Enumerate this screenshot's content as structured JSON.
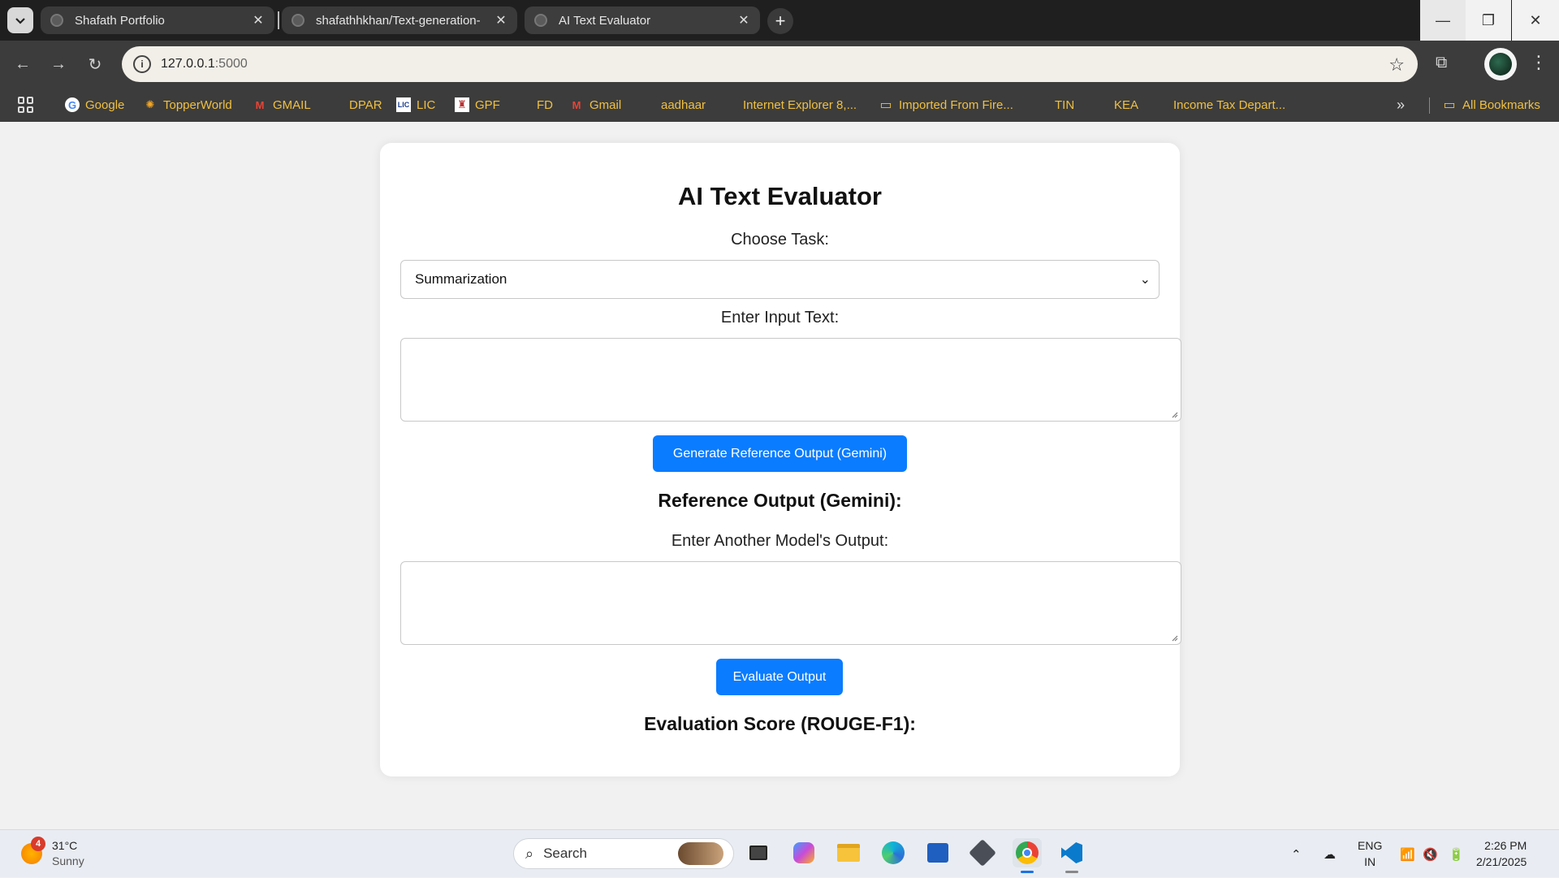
{
  "browser": {
    "tabs": [
      {
        "title": "Shafath Portfolio",
        "active": false
      },
      {
        "title": "shafathhkhan/Text-generation-",
        "active": false
      },
      {
        "title": "AI Text Evaluator",
        "active": true
      }
    ],
    "url_host": "127.0.0.1",
    "url_port": ":5000",
    "bookmarks": [
      {
        "label": "Google",
        "icon": "google-icon"
      },
      {
        "label": "TopperWorld",
        "icon": "topperworld-icon"
      },
      {
        "label": "GMAIL",
        "icon": "gmail-icon"
      },
      {
        "label": "DPAR",
        "icon": "globe-icon"
      },
      {
        "label": "LIC",
        "icon": "lic-icon"
      },
      {
        "label": "GPF",
        "icon": "gpf-icon"
      },
      {
        "label": "FD",
        "icon": "globe-icon"
      },
      {
        "label": "Gmail",
        "icon": "gmail-icon"
      },
      {
        "label": "aadhaar",
        "icon": "globe-icon"
      },
      {
        "label": "Internet Explorer 8,...",
        "icon": "globe-icon"
      },
      {
        "label": "Imported From Fire...",
        "icon": "folder-icon"
      },
      {
        "label": "TIN",
        "icon": "globe-icon"
      },
      {
        "label": "KEA",
        "icon": "globe-icon"
      },
      {
        "label": "Income Tax Depart...",
        "icon": "globe-icon"
      }
    ],
    "more_bookmarks": "»",
    "all_bookmarks": "All Bookmarks",
    "colors": {
      "tabbar": "#1f1f1f",
      "toolbar": "#3c3c3c",
      "bookmark_text": "#f0c040"
    }
  },
  "app": {
    "title": "AI Text Evaluator",
    "task_label": "Choose Task:",
    "task_selected": "Summarization",
    "input_label": "Enter Input Text:",
    "input_value": "",
    "generate_button": "Generate Reference Output (Gemini)",
    "reference_heading": "Reference Output (Gemini):",
    "other_label": "Enter Another Model's Output:",
    "other_value": "",
    "evaluate_button": "Evaluate Output",
    "score_heading": "Evaluation Score (ROUGE-F1):",
    "colors": {
      "accent": "#0a7cff",
      "card": "#ffffff",
      "background": "#f1f1f1"
    }
  },
  "taskbar": {
    "weather_temp": "31°C",
    "weather_cond": "Sunny",
    "weather_badge": "4",
    "search_placeholder": "Search",
    "lang_top": "ENG",
    "lang_bottom": "IN",
    "time": "2:26 PM",
    "date": "2/21/2025"
  }
}
